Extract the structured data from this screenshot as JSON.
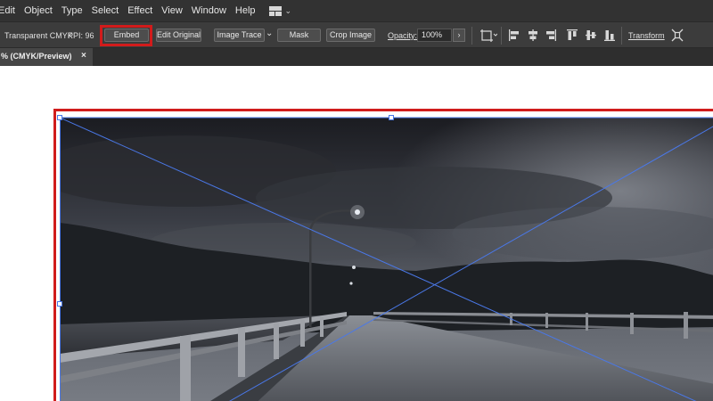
{
  "menu": [
    "Edit",
    "Object",
    "Type",
    "Select",
    "Effect",
    "View",
    "Window",
    "Help"
  ],
  "workspace_icon": "workspace-switcher-icon",
  "control_bar": {
    "color_mode": "Transparent CMYK",
    "ppi_label": "PPI: 96",
    "embed": "Embed",
    "edit_original": "Edit Original",
    "image_trace": "Image Trace",
    "mask": "Mask",
    "crop_image": "Crop Image",
    "opacity_label": "Opacity:",
    "opacity_value": "100%",
    "transform": "Transform"
  },
  "tab": {
    "title": "% (CMYK/Preview)",
    "close": "×"
  },
  "colors": {
    "highlight": "#d21b1b",
    "selection": "#4a78e8",
    "menubar": "#323232",
    "controlbar": "#3c3c3c"
  }
}
